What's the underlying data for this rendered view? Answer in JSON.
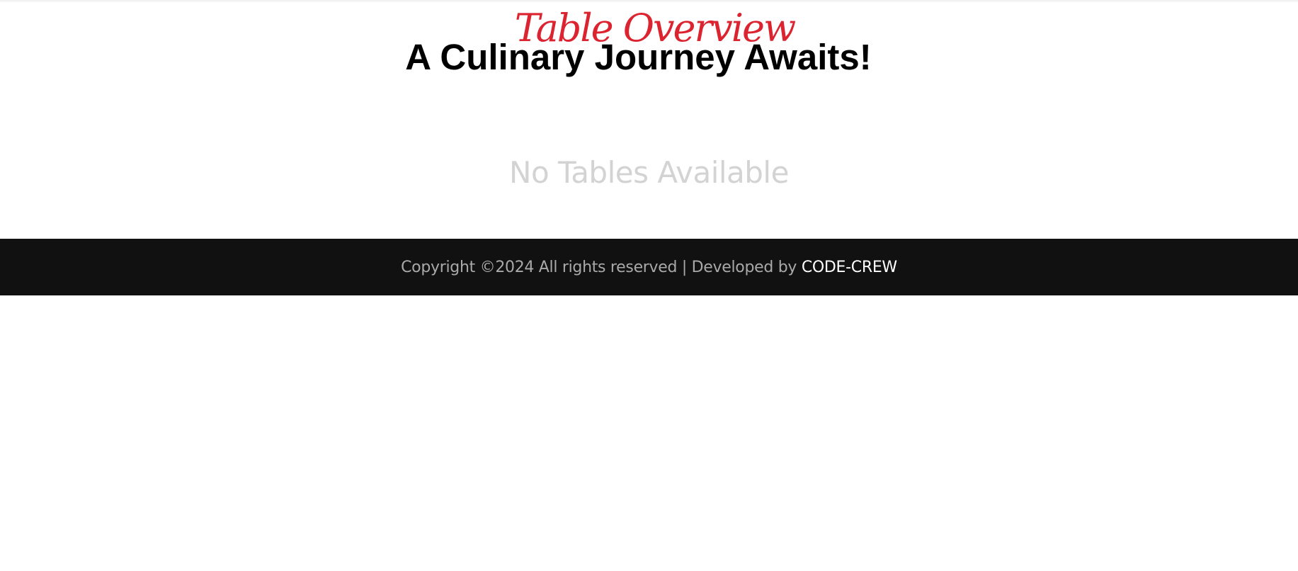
{
  "header": {
    "subtitle": "Table Overview",
    "title": "A Culinary Journey Awaits!"
  },
  "main": {
    "empty_message": "No Tables Available"
  },
  "footer": {
    "copyright": "Copyright ©2024 All rights reserved | Developed by ",
    "developer": "CODE-CREW"
  },
  "colors": {
    "accent": "#dc2430",
    "footer_bg": "#111111",
    "muted": "#d3d3d3"
  }
}
